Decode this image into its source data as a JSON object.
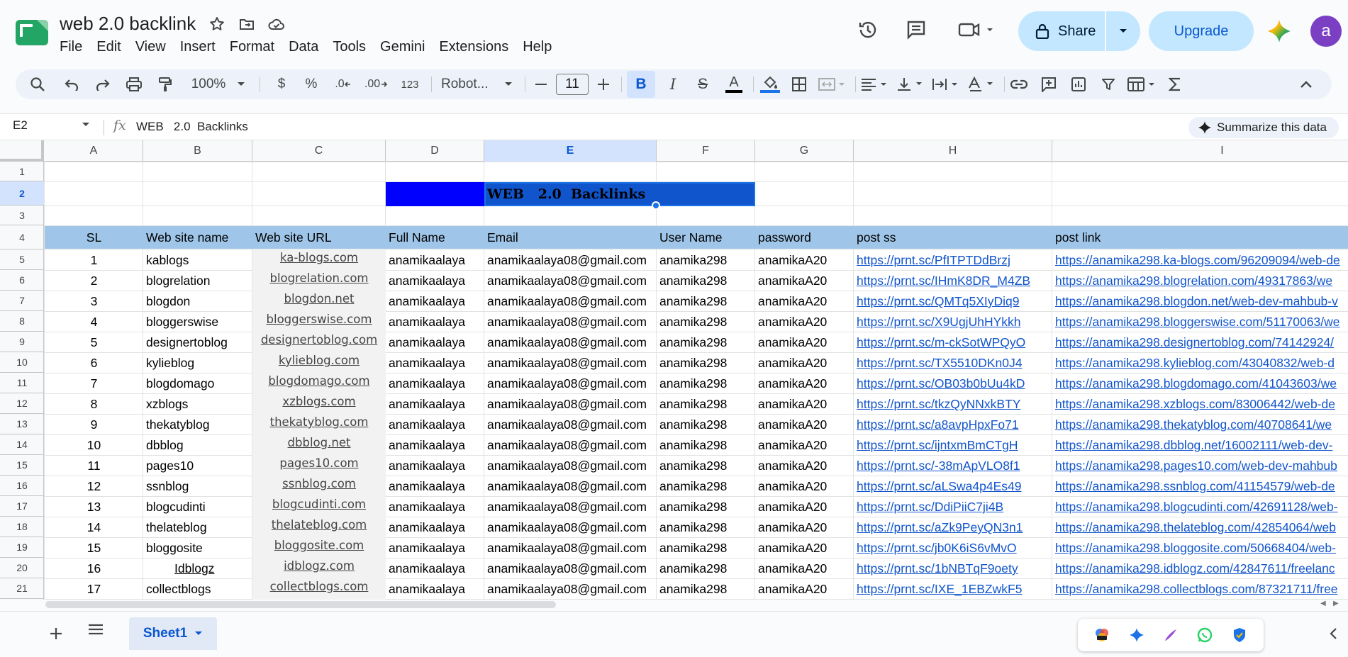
{
  "app": {
    "doc_title": "web 2.0 backlink",
    "menu": [
      "File",
      "Edit",
      "View",
      "Insert",
      "Format",
      "Data",
      "Tools",
      "Gemini",
      "Extensions",
      "Help"
    ],
    "share_label": "Share",
    "upgrade_label": "Upgrade",
    "avatar_letter": "a",
    "colors": {
      "accent": "#0b57d0",
      "share_bg": "#c2e7ff",
      "header_band": "#9fc5e8",
      "title_blue": "#0000ff",
      "title_blue_dark": "#1155cc",
      "link": "#1155cc"
    }
  },
  "toolbar": {
    "zoom": "100%",
    "currency": "$",
    "percent": "%",
    "decrease_decimal": ".0",
    "increase_decimal": ".00",
    "number_format": "123",
    "font": "Robot...",
    "font_size": "11",
    "bold": "B",
    "italic": "I",
    "strike": "S",
    "text_color": "A"
  },
  "formula_bar": {
    "cell_ref": "E2",
    "fx": "fx",
    "content": "WEB   2.0  Backlinks",
    "summarize": "Summarize this data"
  },
  "grid": {
    "columns": [
      "A",
      "B",
      "C",
      "D",
      "E",
      "F",
      "G",
      "H",
      "I"
    ],
    "selected_column": "E",
    "rows": [
      "1",
      "2",
      "3",
      "4",
      "5",
      "6",
      "7",
      "8",
      "9",
      "10",
      "11",
      "12",
      "13",
      "14",
      "15",
      "16",
      "17",
      "18",
      "19",
      "20",
      "21"
    ],
    "selected_row": "2",
    "title": "WEB   2.0  Backlinks",
    "headers": [
      "SL",
      "Web site name",
      "Web site URL",
      "Full Name",
      "Email",
      "User Name",
      "password",
      "post ss",
      "post link"
    ],
    "data": [
      [
        "1",
        "kablogs",
        "ka-blogs.com",
        "anamikaalaya",
        "anamikaalaya08@gmail.com",
        "anamika298",
        "anamikaA20",
        "https://prnt.sc/PfITPTDdBrzj",
        "https://anamika298.ka-blogs.com/96209094/web-de"
      ],
      [
        "2",
        "blogrelation",
        "blogrelation.com",
        "anamikaalaya",
        "anamikaalaya08@gmail.com",
        "anamika298",
        "anamikaA20",
        "https://prnt.sc/IHmK8DR_M4ZB",
        "https://anamika298.blogrelation.com/49317863/we"
      ],
      [
        "3",
        "blogdon",
        "blogdon.net",
        "anamikaalaya",
        "anamikaalaya08@gmail.com",
        "anamika298",
        "anamikaA20",
        "https://prnt.sc/QMTq5XIyDiq9",
        "https://anamika298.blogdon.net/web-dev-mahbub-v"
      ],
      [
        "4",
        "bloggerswise",
        "bloggerswise.com",
        "anamikaalaya",
        "anamikaalaya08@gmail.com",
        "anamika298",
        "anamikaA20",
        "https://prnt.sc/X9UgjUhHYkkh",
        "https://anamika298.bloggerswise.com/51170063/we"
      ],
      [
        "5",
        "designertoblog",
        "designertoblog.com",
        "anamikaalaya",
        "anamikaalaya08@gmail.com",
        "anamika298",
        "anamikaA20",
        "https://prnt.sc/m-ckSotWPQyO",
        "https://anamika298.designertoblog.com/74142924/"
      ],
      [
        "6",
        "kylieblog",
        "kylieblog.com",
        "anamikaalaya",
        "anamikaalaya08@gmail.com",
        "anamika298",
        "anamikaA20",
        "https://prnt.sc/TX5510DKn0J4",
        "https://anamika298.kylieblog.com/43040832/web-d"
      ],
      [
        "7",
        "blogdomago",
        "blogdomago.com",
        "anamikaalaya",
        "anamikaalaya08@gmail.com",
        "anamika298",
        "anamikaA20",
        "https://prnt.sc/OB03b0bUu4kD",
        "https://anamika298.blogdomago.com/41043603/we"
      ],
      [
        "8",
        "xzblogs",
        "xzblogs.com",
        "anamikaalaya",
        "anamikaalaya08@gmail.com",
        "anamika298",
        "anamikaA20",
        "https://prnt.sc/tkzQyNNxkBTY",
        "https://anamika298.xzblogs.com/83006442/web-de"
      ],
      [
        "9",
        "thekatyblog",
        "thekatyblog.com",
        "anamikaalaya",
        "anamikaalaya08@gmail.com",
        "anamika298",
        "anamikaA20",
        "https://prnt.sc/a8avpHpxFo71",
        "https://anamika298.thekatyblog.com/40708641/we"
      ],
      [
        "10",
        "dbblog",
        "dbblog.net",
        "anamikaalaya",
        "anamikaalaya08@gmail.com",
        "anamika298",
        "anamikaA20",
        "https://prnt.sc/ijntxmBmCTgH",
        "https://anamika298.dbblog.net/16002111/web-dev-"
      ],
      [
        "11",
        "pages10",
        "pages10.com",
        "anamikaalaya",
        "anamikaalaya08@gmail.com",
        "anamika298",
        "anamikaA20",
        "https://prnt.sc/-38mApVLO8f1",
        "https://anamika298.pages10.com/web-dev-mahbub"
      ],
      [
        "12",
        "ssnblog",
        "ssnblog.com",
        "anamikaalaya",
        "anamikaalaya08@gmail.com",
        "anamika298",
        "anamikaA20",
        "https://prnt.sc/aLSwa4p4Es49",
        "https://anamika298.ssnblog.com/41154579/web-de"
      ],
      [
        "13",
        "blogcudinti",
        "blogcudinti.com",
        "anamikaalaya",
        "anamikaalaya08@gmail.com",
        "anamika298",
        "anamikaA20",
        "https://prnt.sc/DdiPiiC7ji4B",
        "https://anamika298.blogcudinti.com/42691128/web-"
      ],
      [
        "14",
        "thelateblog",
        "thelateblog.com",
        "anamikaalaya",
        "anamikaalaya08@gmail.com",
        "anamika298",
        "anamikaA20",
        "https://prnt.sc/aZk9PeyQN3n1",
        "https://anamika298.thelateblog.com/42854064/web"
      ],
      [
        "15",
        "bloggosite",
        "bloggosite.com",
        "anamikaalaya",
        "anamikaalaya08@gmail.com",
        "anamika298",
        "anamikaA20",
        "https://prnt.sc/jb0K6iS6vMvO",
        "https://anamika298.bloggosite.com/50668404/web-"
      ],
      [
        "16",
        "Idblogz",
        "idblogz.com",
        "anamikaalaya",
        "anamikaalaya08@gmail.com",
        "anamika298",
        "anamikaA20",
        "https://prnt.sc/1bNBTqF9oety",
        "https://anamika298.idblogz.com/42847611/freelanc"
      ],
      [
        "17",
        "collectblogs",
        "collectblogs.com",
        "anamikaalaya",
        "anamikaalaya08@gmail.com",
        "anamika298",
        "anamikaA20",
        "https://prnt.sc/IXE_1EBZwkF5",
        "https://anamika298.collectblogs.com/87321711/free"
      ]
    ]
  },
  "sheets": {
    "active": "Sheet1"
  }
}
